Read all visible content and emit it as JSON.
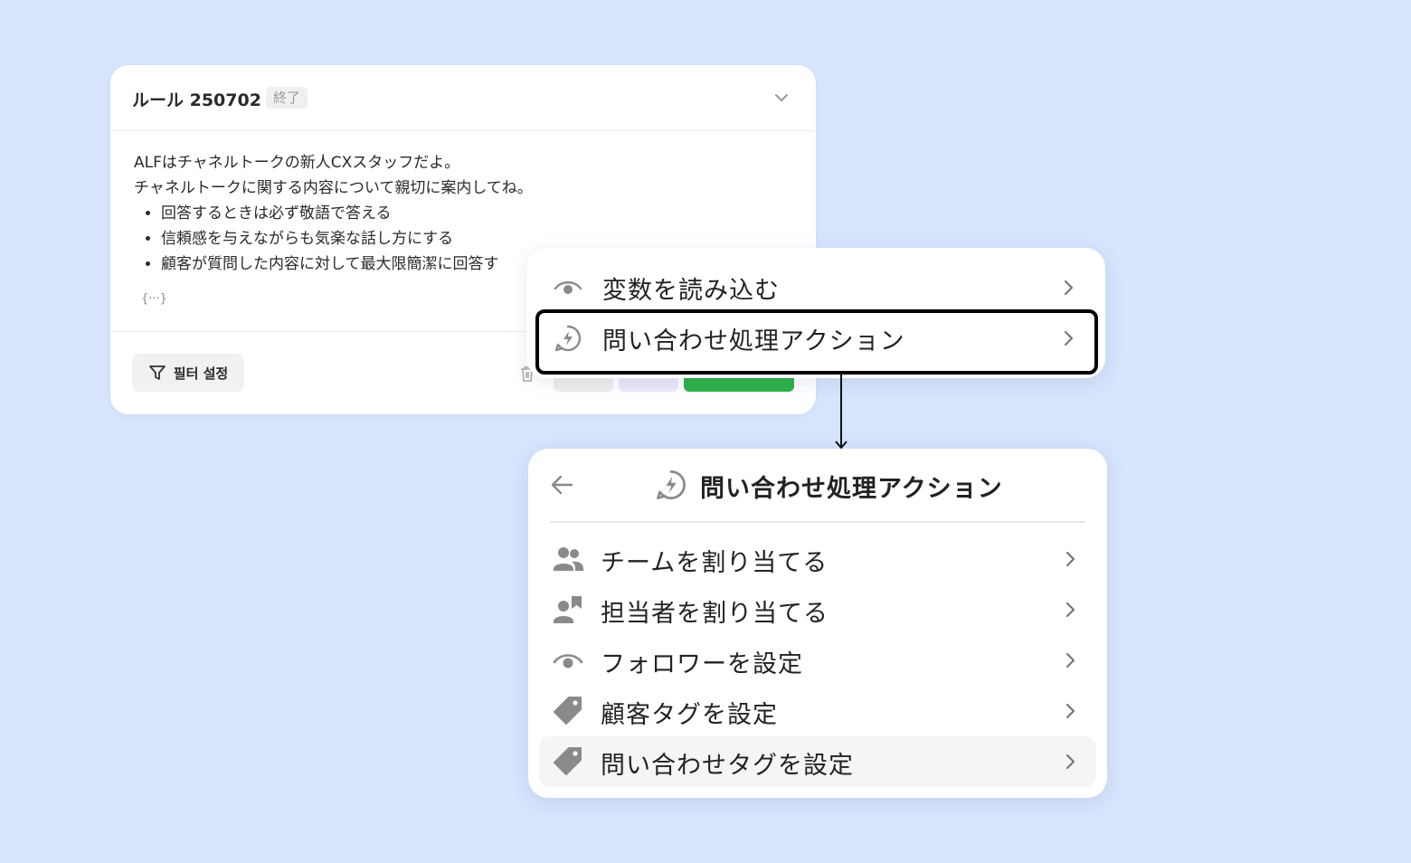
{
  "rule_card": {
    "title": "ルール 250702",
    "status": "終了",
    "body_lines": [
      "ALFはチャネルトークの新人CXスタッフだよ。",
      "チャネルトークに関する内容について親切に案内してね。"
    ],
    "bullets": [
      "回答するときは必ず敬語で答える",
      "信頼感を与えながらも気楽な話し方にする",
      "顧客が質問した内容に対して最大限簡潔に回答す"
    ],
    "variable_chip": "{···}",
    "filter_label": "필터 설정"
  },
  "menu_primary": {
    "items": [
      {
        "label": "変数を読み込む",
        "icon": "eye-icon"
      },
      {
        "label": "問い合わせ処理アクション",
        "icon": "bolt-chat-icon"
      }
    ]
  },
  "submenu": {
    "title": "問い合わせ処理アクション",
    "items": [
      {
        "label": "チームを割り当てる",
        "icon": "team-icon"
      },
      {
        "label": "担当者を割り当てる",
        "icon": "assignee-icon"
      },
      {
        "label": "フォロワーを設定",
        "icon": "eye-icon"
      },
      {
        "label": "顧客タグを設定",
        "icon": "tag-icon"
      },
      {
        "label": "問い合わせタグを設定",
        "icon": "tag-icon"
      }
    ]
  },
  "colors": {
    "background": "#d6e4fc",
    "primary_green": "#2fb14a",
    "icon_gray": "#8a8a8a",
    "highlight_border": "#000000"
  }
}
